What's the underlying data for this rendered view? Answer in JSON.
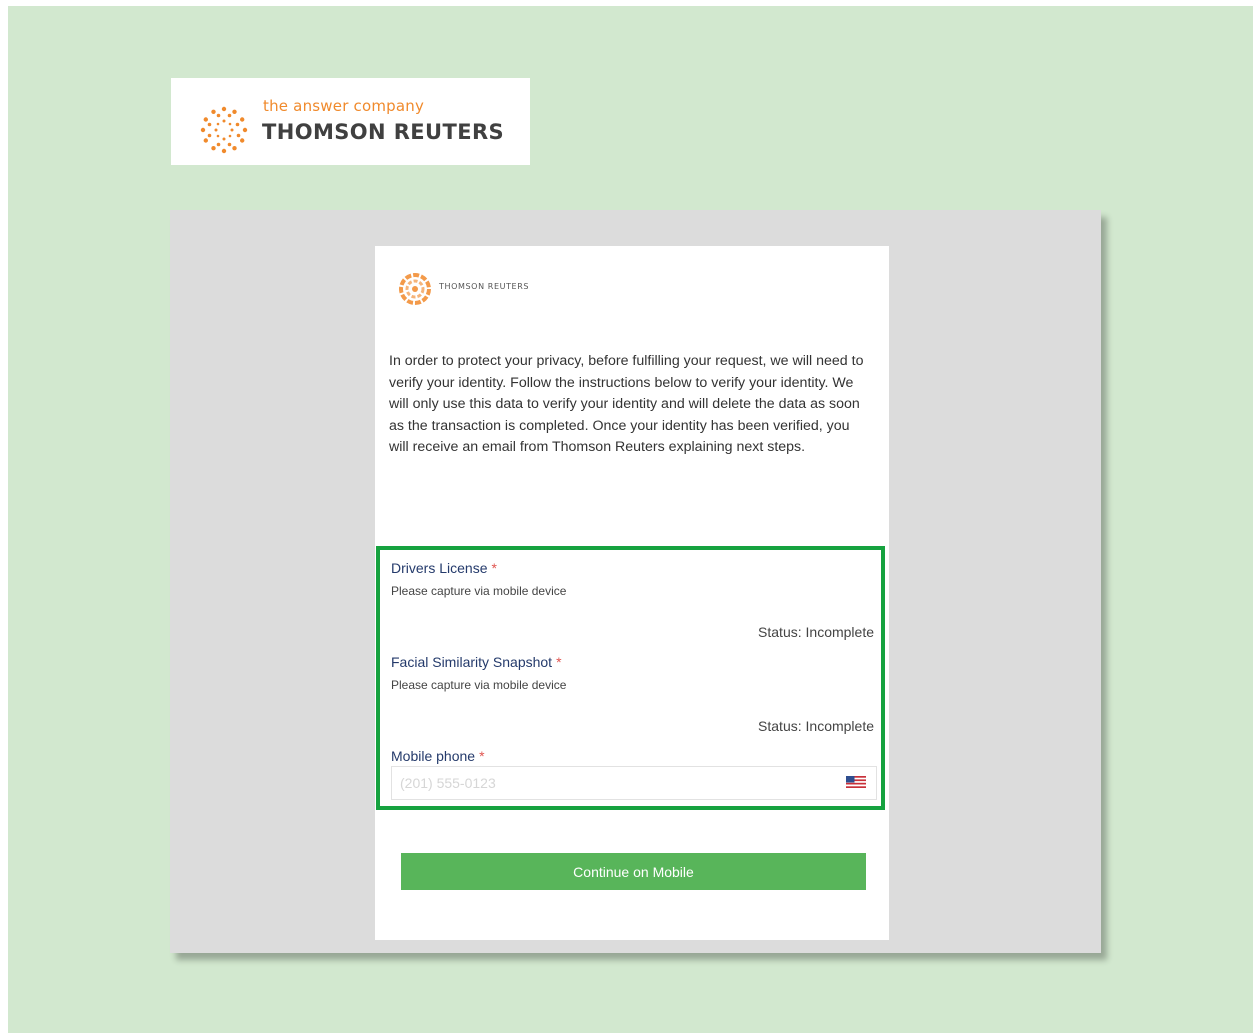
{
  "brand": {
    "tagline": "the answer company",
    "name": "THOMSON REUTERS",
    "accent_color": "#f08a2c",
    "logo_icon": "thomson-reuters-dotted-circle-logo"
  },
  "card": {
    "logo_text": "THOMSON REUTERS",
    "logo_icon": "thomson-reuters-swirl-logo",
    "intro": "In order to protect your privacy, before fulfilling your request, we will need to verify your identity. Follow the instructions below to verify your identity. We will only use this data to verify your identity and will delete the data as soon as the transaction is completed. Once your identity has been verified, you will receive an email from Thomson Reuters explaining next steps."
  },
  "requirements": {
    "highlight_color": "#16a23f",
    "required_marker": "*",
    "drivers_license": {
      "label": "Drivers License",
      "help": "Please capture via mobile device",
      "status": "Status: Incomplete"
    },
    "facial_snapshot": {
      "label": "Facial Similarity Snapshot",
      "help": "Please capture via mobile device",
      "status": "Status: Incomplete"
    },
    "mobile_phone": {
      "label": "Mobile phone",
      "placeholder": "(201) 555-0123",
      "value": "",
      "country_icon": "us-flag-icon"
    }
  },
  "actions": {
    "continue_label": "Continue on Mobile",
    "button_color": "#58b55a"
  }
}
